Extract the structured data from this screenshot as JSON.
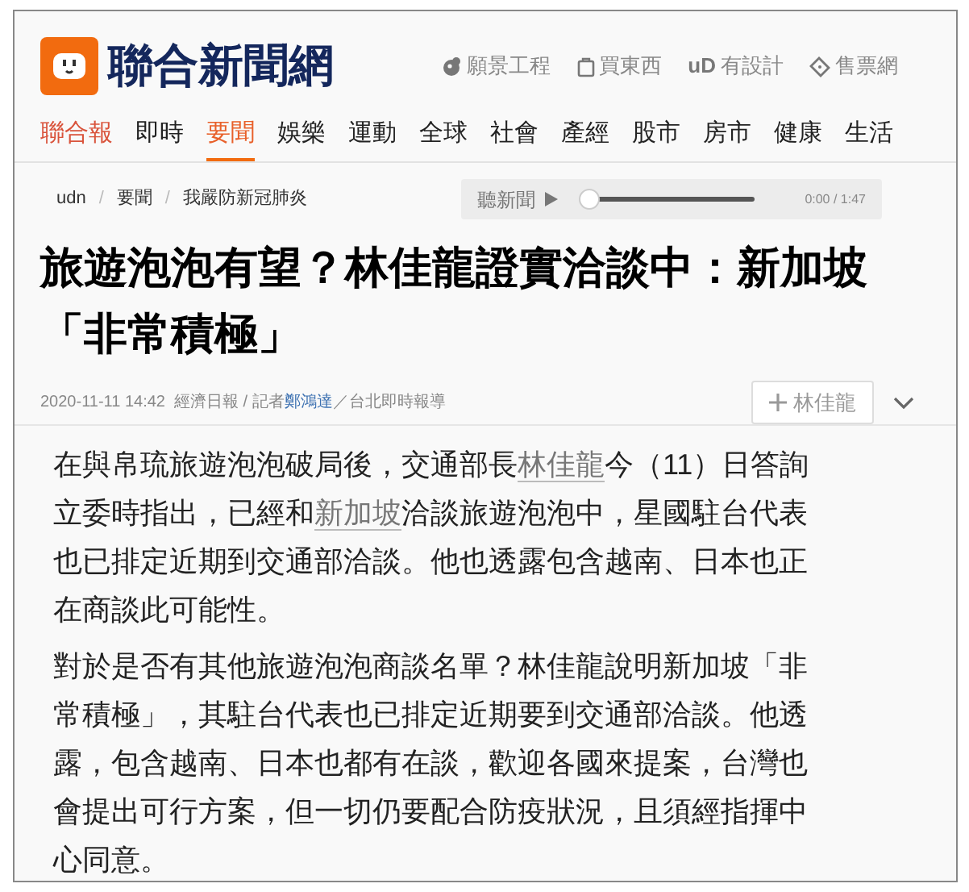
{
  "header": {
    "logo_text": "聯合新聞網",
    "links": [
      {
        "text": "願景工程"
      },
      {
        "text": "買東西"
      },
      {
        "badge": "uD",
        "text": "有設計"
      },
      {
        "text": "售票網"
      }
    ]
  },
  "nav": [
    {
      "label": "聯合報",
      "selected": false,
      "kind": "brand"
    },
    {
      "label": "即時",
      "selected": false,
      "kind": "item"
    },
    {
      "label": "要聞",
      "selected": true,
      "kind": "item"
    },
    {
      "label": "娛樂",
      "selected": false,
      "kind": "item"
    },
    {
      "label": "運動",
      "selected": false,
      "kind": "item"
    },
    {
      "label": "全球",
      "selected": false,
      "kind": "item"
    },
    {
      "label": "社會",
      "selected": false,
      "kind": "item"
    },
    {
      "label": "產經",
      "selected": false,
      "kind": "item"
    },
    {
      "label": "股市",
      "selected": false,
      "kind": "item"
    },
    {
      "label": "房市",
      "selected": false,
      "kind": "item"
    },
    {
      "label": "健康",
      "selected": false,
      "kind": "item"
    },
    {
      "label": "生活",
      "selected": false,
      "kind": "item"
    }
  ],
  "breadcrumb": {
    "separator": "/",
    "items": [
      "udn",
      "要聞",
      "我嚴防新冠肺炎"
    ]
  },
  "player": {
    "label": "聽新聞",
    "level": 0,
    "time": "0:00 / 1:47"
  },
  "headline": "旅遊泡泡有望？林佳龍證實洽談中：新加坡「非常積極」",
  "meta": {
    "date": "2020-11-11 14:42",
    "source": "經濟日報 / 記者",
    "author": "鄭鴻達",
    "location": "／台北即時報導"
  },
  "follow_button": "林佳龍",
  "paragraphs": [
    [
      {
        "kind": "text",
        "text": "在與帛琉旅遊泡泡破局後，交通部長"
      },
      {
        "kind": "link",
        "text": "林佳龍"
      },
      {
        "kind": "text",
        "text": "今（11）日答詢立委時指出，已經和"
      },
      {
        "kind": "link",
        "text": "新加坡"
      },
      {
        "kind": "text",
        "text": "洽談旅遊泡泡中，星國駐台代表也已排定近期到交通部洽談。他也透露包含越南、日本也正在商談此可能性。"
      }
    ],
    [
      {
        "kind": "text",
        "text": "對於是否有其他旅遊泡泡商談名單？林佳龍說明新加坡「非常積極」，其駐台代表也已排定近期要到交通部洽談。他透露，包含越南、日本也都有在談，歡迎各國來提案，台灣也會提出可行方案，但一切仍要配合防疫狀況，且須經指揮中心同意。"
      }
    ]
  ]
}
